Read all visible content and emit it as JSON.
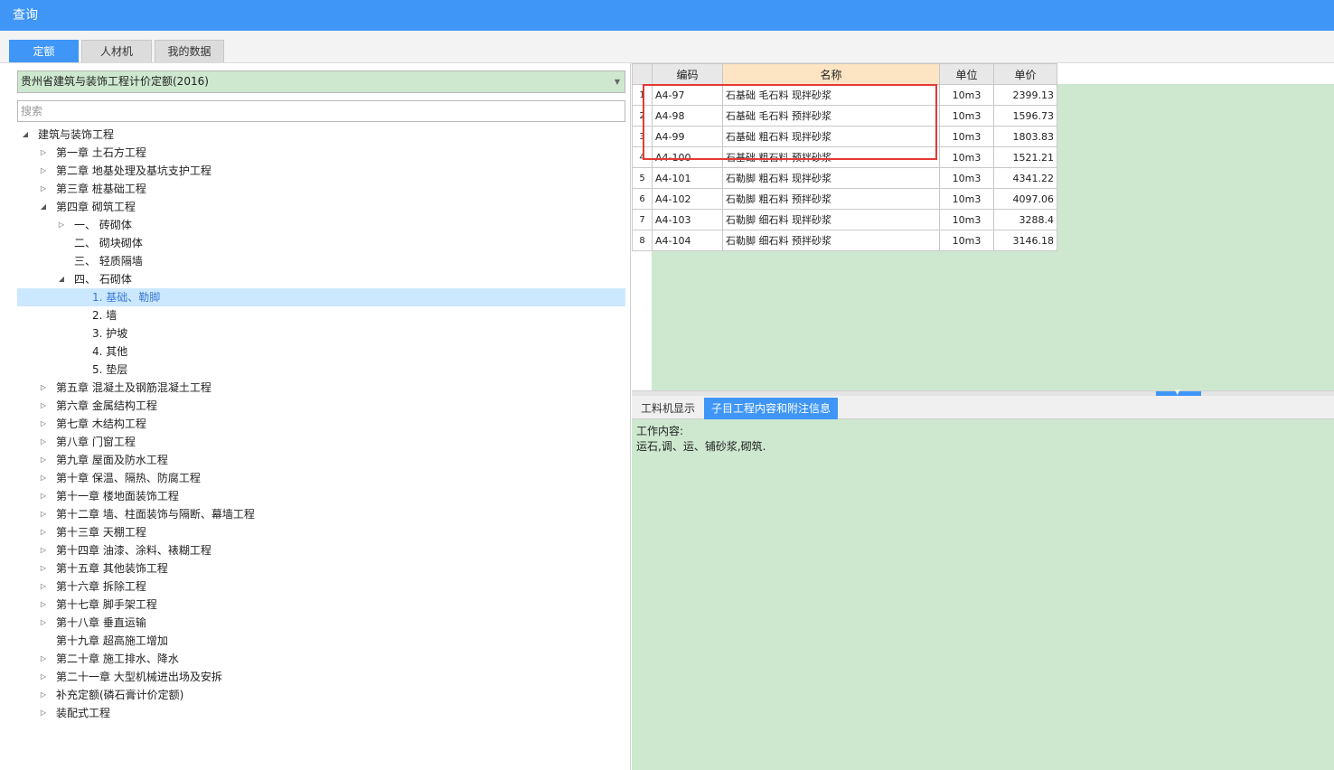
{
  "window": {
    "title": "查询"
  },
  "tabs": [
    {
      "label": "定额",
      "active": true
    },
    {
      "label": "人材机",
      "active": false
    },
    {
      "label": "我的数据",
      "active": false
    }
  ],
  "left": {
    "library_select": "贵州省建筑与装饰工程计价定额(2016)",
    "search_placeholder": "搜索",
    "tree": [
      {
        "label": "建筑与装饰工程",
        "level": 0,
        "toggle": "expanded"
      },
      {
        "label": "第一章 土石方工程",
        "level": 1,
        "toggle": "collapsed"
      },
      {
        "label": "第二章 地基处理及基坑支护工程",
        "level": 1,
        "toggle": "collapsed"
      },
      {
        "label": "第三章 桩基础工程",
        "level": 1,
        "toggle": "collapsed"
      },
      {
        "label": "第四章 砌筑工程",
        "level": 1,
        "toggle": "expanded"
      },
      {
        "label": "一、  砖砌体",
        "level": 2,
        "toggle": "collapsed"
      },
      {
        "label": "二、  砌块砌体",
        "level": 2,
        "toggle": "none"
      },
      {
        "label": "三、  轻质隔墙",
        "level": 2,
        "toggle": "none"
      },
      {
        "label": "四、  石砌体",
        "level": 2,
        "toggle": "expanded"
      },
      {
        "label": "1. 基础、勒脚",
        "level": 3,
        "toggle": "none",
        "selected": true
      },
      {
        "label": "2. 墙",
        "level": 3,
        "toggle": "none"
      },
      {
        "label": "3. 护坡",
        "level": 3,
        "toggle": "none"
      },
      {
        "label": "4. 其他",
        "level": 3,
        "toggle": "none"
      },
      {
        "label": "5. 垫层",
        "level": 3,
        "toggle": "none"
      },
      {
        "label": "第五章 混凝土及钢筋混凝土工程",
        "level": 1,
        "toggle": "collapsed"
      },
      {
        "label": "第六章 金属结构工程",
        "level": 1,
        "toggle": "collapsed"
      },
      {
        "label": "第七章 木结构工程",
        "level": 1,
        "toggle": "collapsed"
      },
      {
        "label": "第八章 门窗工程",
        "level": 1,
        "toggle": "collapsed"
      },
      {
        "label": "第九章 屋面及防水工程",
        "level": 1,
        "toggle": "collapsed"
      },
      {
        "label": "第十章 保温、隔热、防腐工程",
        "level": 1,
        "toggle": "collapsed"
      },
      {
        "label": "第十一章 楼地面装饰工程",
        "level": 1,
        "toggle": "collapsed"
      },
      {
        "label": "第十二章 墙、柱面装饰与隔断、幕墙工程",
        "level": 1,
        "toggle": "collapsed"
      },
      {
        "label": "第十三章 天棚工程",
        "level": 1,
        "toggle": "collapsed"
      },
      {
        "label": "第十四章 油漆、涂料、裱糊工程",
        "level": 1,
        "toggle": "collapsed"
      },
      {
        "label": "第十五章 其他装饰工程",
        "level": 1,
        "toggle": "collapsed"
      },
      {
        "label": "第十六章 拆除工程",
        "level": 1,
        "toggle": "collapsed"
      },
      {
        "label": "第十七章 脚手架工程",
        "level": 1,
        "toggle": "collapsed"
      },
      {
        "label": "第十八章 垂直运输",
        "level": 1,
        "toggle": "collapsed"
      },
      {
        "label": "第十九章 超高施工增加",
        "level": 1,
        "toggle": "none"
      },
      {
        "label": "第二十章 施工排水、降水",
        "level": 1,
        "toggle": "collapsed"
      },
      {
        "label": "第二十一章 大型机械进出场及安拆",
        "level": 1,
        "toggle": "collapsed"
      },
      {
        "label": "补充定额(磷石膏计价定额)",
        "level": 1,
        "toggle": "collapsed"
      },
      {
        "label": "装配式工程",
        "level": 1,
        "toggle": "collapsed"
      }
    ]
  },
  "grid": {
    "headers": [
      "编码",
      "名称",
      "单位",
      "单价"
    ],
    "rows": [
      {
        "num": "1",
        "code": "A4-97",
        "name": "石基础 毛石料 现拌砂浆",
        "unit": "10m3",
        "price": "2399.13"
      },
      {
        "num": "2",
        "code": "A4-98",
        "name": "石基础 毛石料 预拌砂浆",
        "unit": "10m3",
        "price": "1596.73"
      },
      {
        "num": "3",
        "code": "A4-99",
        "name": "石基础 粗石料 现拌砂浆",
        "unit": "10m3",
        "price": "1803.83"
      },
      {
        "num": "4",
        "code": "A4-100",
        "name": "石基础 粗石料 预拌砂浆",
        "unit": "10m3",
        "price": "1521.21"
      },
      {
        "num": "5",
        "code": "A4-101",
        "name": "石勒脚 粗石料 现拌砂浆",
        "unit": "10m3",
        "price": "4341.22"
      },
      {
        "num": "6",
        "code": "A4-102",
        "name": "石勒脚 粗石料 预拌砂浆",
        "unit": "10m3",
        "price": "4097.06"
      },
      {
        "num": "7",
        "code": "A4-103",
        "name": "石勒脚 细石料 现拌砂浆",
        "unit": "10m3",
        "price": "3288.4"
      },
      {
        "num": "8",
        "code": "A4-104",
        "name": "石勒脚 细石料 预拌砂浆",
        "unit": "10m3",
        "price": "3146.18"
      }
    ]
  },
  "bottom": {
    "tabs": [
      {
        "label": "工料机显示",
        "active": false
      },
      {
        "label": "子目工程内容和附注信息",
        "active": true
      }
    ],
    "content_title": "工作内容:",
    "content_body": "运石,调、运、铺砂浆,砌筑."
  }
}
